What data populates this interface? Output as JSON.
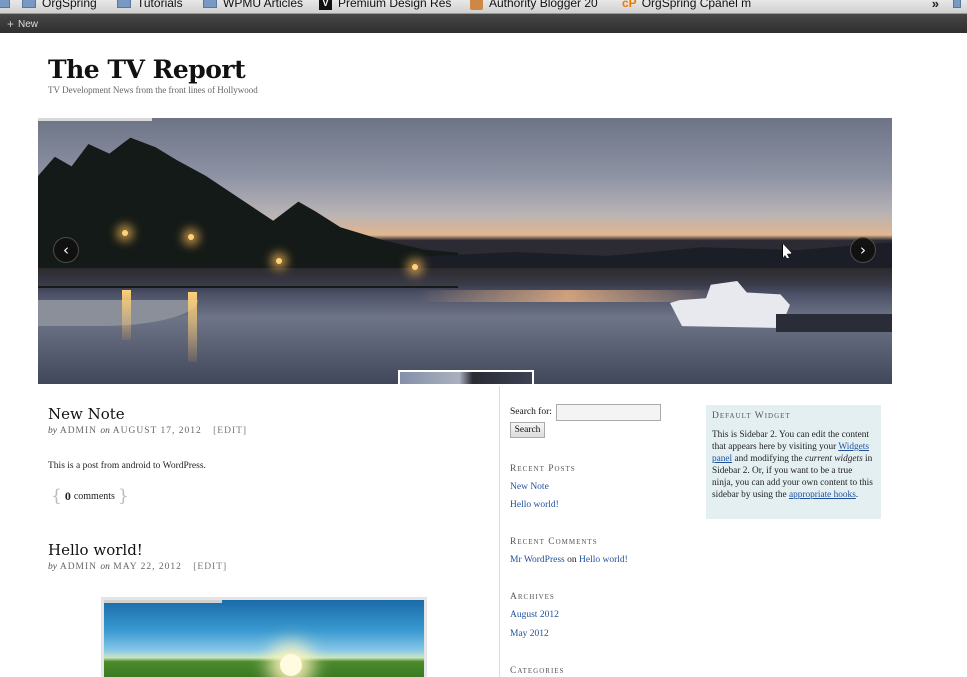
{
  "bookmarks": {
    "items": [
      {
        "label": "OrgSpring",
        "icon": "folder-icon"
      },
      {
        "label": "Tutorials",
        "icon": "folder-icon"
      },
      {
        "label": "WPMU Articles",
        "icon": "folder-icon"
      },
      {
        "label": "Premium Design Res",
        "icon": "v-logo-icon"
      },
      {
        "label": "Authority Blogger 20",
        "icon": "authority-logo-icon"
      },
      {
        "label": "OrgSpring Cpanel m",
        "icon": "cpanel-icon"
      }
    ],
    "overflow": "»"
  },
  "adminbar": {
    "new_label": "New"
  },
  "site": {
    "title": "The TV Report",
    "description": "TV Development News from the front lines of Hollywood"
  },
  "slider": {
    "prev": "‹",
    "next": "›"
  },
  "posts": [
    {
      "title": "New Note",
      "by": "by",
      "author": "ADMIN",
      "on": "on",
      "date": "AUGUST 17, 2012",
      "edit": "[EDIT]",
      "body": "This is a post from android to WordPress.",
      "comments_count": "0",
      "comments_label": "comments"
    },
    {
      "title": "Hello world!",
      "by": "by",
      "author": "ADMIN",
      "on": "on",
      "date": "MAY 22, 2012",
      "edit": "[EDIT]"
    }
  ],
  "search": {
    "label": "Search for:",
    "value": "",
    "button": "Search"
  },
  "sidebar": {
    "recent_posts": {
      "title": "Recent Posts",
      "items": [
        "New Note",
        "Hello world!"
      ]
    },
    "recent_comments": {
      "title": "Recent Comments",
      "author": "Mr WordPress",
      "on": "on",
      "post": "Hello world!"
    },
    "archives": {
      "title": "Archives",
      "items": [
        "August 2012",
        "May 2012"
      ]
    },
    "categories": {
      "title": "Categories"
    }
  },
  "default_widget": {
    "title": "Default Widget",
    "t1": "This is Sidebar 2. You can edit the content that appears here by visiting your ",
    "link1": "Widgets panel",
    "t2": " and modifying the ",
    "em1": "current widgets",
    "t3": " in Sidebar 2. Or, if you want to be a true ninja, you can add your own content to this sidebar by using the ",
    "link2": "appropriate hooks",
    "t4": "."
  }
}
